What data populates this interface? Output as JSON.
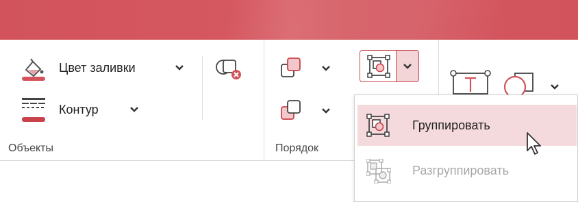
{
  "ribbon": {
    "objects": {
      "fill_color_label": "Цвет заливки",
      "outline_label": "Контур",
      "group_label": "Объекты"
    },
    "arrange": {
      "group_label": "Порядок"
    }
  },
  "dropdown": {
    "group_label": "Группировать",
    "ungroup_label": "Разгруппировать"
  },
  "colors": {
    "accent": "#d2535c",
    "accent_dark": "#c8434b",
    "hover_bg": "#f5dadd"
  }
}
